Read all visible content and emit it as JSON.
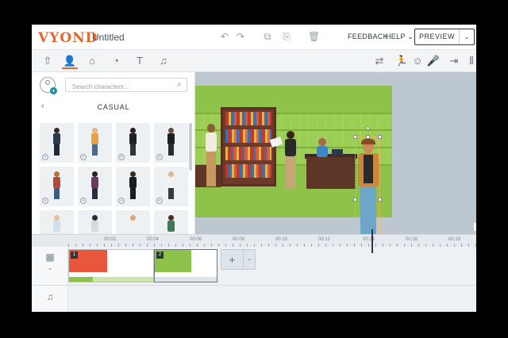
{
  "app": {
    "logo": "VYOND",
    "doc_title": "Untitled"
  },
  "topbar": {
    "feedback": "FEEDBACK",
    "help": "HELP ⌄",
    "preview": "PREVIEW",
    "icons": [
      "undo-icon",
      "redo-icon",
      "copy-icon",
      "paste-icon",
      "trash-icon"
    ]
  },
  "toolbar": {
    "left_tabs": [
      "upload-icon",
      "character-icon",
      "props-icon",
      "chart-icon",
      "text-icon",
      "audio-icon"
    ],
    "active_tab": "character-icon",
    "right_tools": [
      "swap-icon",
      "action-icon",
      "expression-icon",
      "mic-icon",
      "enter-icon",
      "more-icon"
    ]
  },
  "library": {
    "search_placeholder": "Search characters...",
    "category": "CASUAL",
    "back_label": "‹"
  },
  "timeline": {
    "ticks": [
      "00:02",
      "00:04",
      "00:06",
      "00:08",
      "00:10",
      "00:12",
      "00:14",
      "00:16",
      "00:18"
    ],
    "clips": [
      {
        "number": "1",
        "color": "#e8573c"
      },
      {
        "number": "2",
        "color": "#8fc24a"
      }
    ],
    "add_scene": "+",
    "add_scene_menu": "⌄"
  },
  "colors": {
    "brand": "#e36a2e",
    "stage_bg": "#8fc24a",
    "bookcase": "#6d3a2a"
  }
}
